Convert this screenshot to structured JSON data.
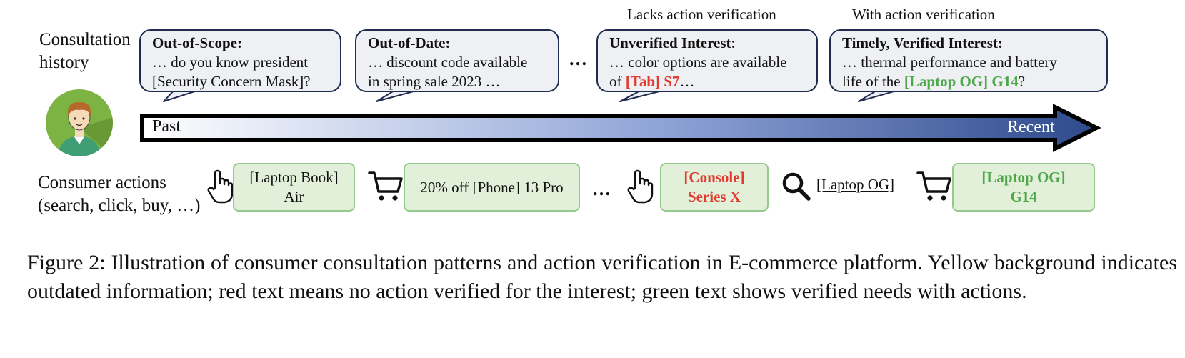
{
  "labels": {
    "history_line1": "Consultation",
    "history_line2": "history",
    "actions_line1": "Consumer actions",
    "actions_line2": "(search, click, buy, …)",
    "lacks_verification": "Lacks action verification",
    "with_verification": "With action verification"
  },
  "bubbles": [
    {
      "title": "Out-of-Scope:",
      "line1": "… do you know president",
      "line2": "[Security Concern Mask]?"
    },
    {
      "title": "Out-of-Date:",
      "line1": "… discount code available",
      "line2": "in spring sale 2023 …"
    },
    {
      "title": "Unverified Interest",
      "title_suffix": ":",
      "line1": "… color options are available",
      "line2_pre": "of ",
      "line2_hl": "[Tab] S7",
      "line2_post": "…"
    },
    {
      "title": "Timely, Verified Interest:",
      "line1": "… thermal performance and battery",
      "line2_pre": "life of the ",
      "line2_hl": "[Laptop OG] G14",
      "line2_post": "?"
    }
  ],
  "ellipsis": "…",
  "timeline": {
    "past": "Past",
    "recent": "Recent"
  },
  "actions": {
    "a1_line1": "[Laptop Book]",
    "a1_line2": "Air",
    "a2": "20% off [Phone] 13 Pro",
    "a3_line1": "[Console]",
    "a3_line2": "Series X",
    "a4_search": "[Laptop OG]",
    "a5_line1": "[Laptop OG]",
    "a5_line2": "G14"
  },
  "caption": "Figure 2: Illustration of consumer consultation patterns and action verification in E-commerce platform. Yellow background indicates outdated information; red text means no action verified for the interest; green text shows verified needs with actions.",
  "colors": {
    "bubble_border": "#1f2c50",
    "bubble_fill": "#eef0f3",
    "action_box_fill": "#e2f0da",
    "action_box_border": "#96c98d",
    "unverified_red": "#e23a2f",
    "verified_green": "#4ea84a",
    "arrow_start": "#ffffff",
    "arrow_end": "#2e4a8c",
    "avatar_bg": "#7db342"
  },
  "icons": [
    "user-avatar-icon",
    "click-hand-icon",
    "shopping-cart-icon",
    "search-icon"
  ]
}
